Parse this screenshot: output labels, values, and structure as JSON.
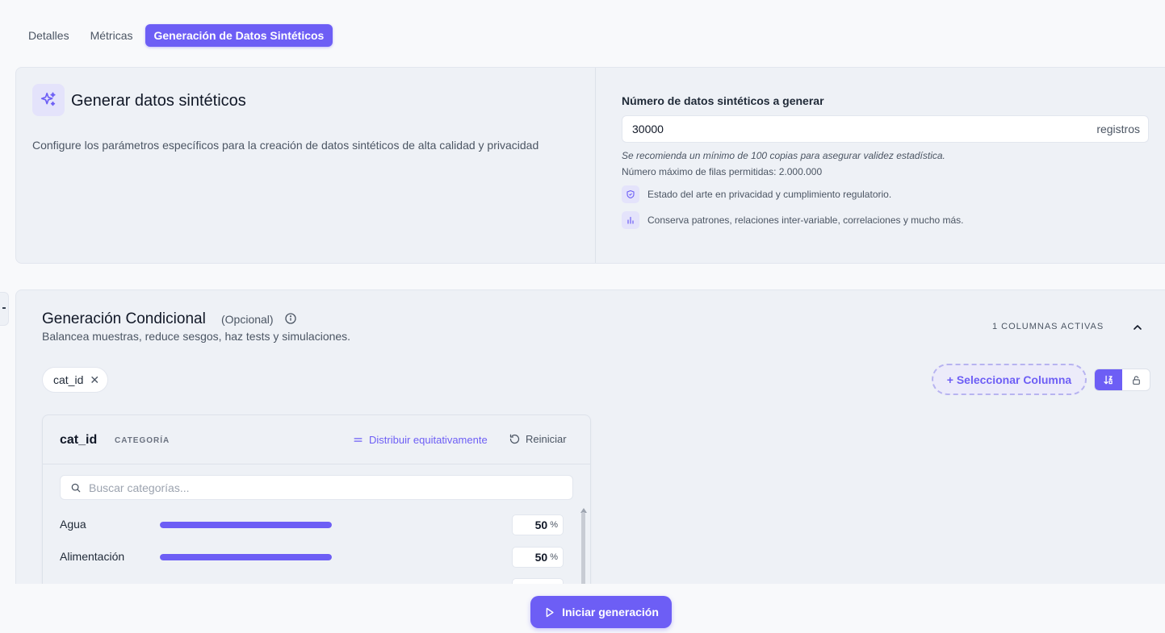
{
  "tabs": [
    {
      "label": "Detalles",
      "active": false
    },
    {
      "label": "Métricas",
      "active": false
    },
    {
      "label": "Generación de Datos Sintéticos",
      "active": true
    }
  ],
  "generate": {
    "title": "Generar datos sintéticos",
    "description": "Configure los parámetros específicos para la creación de datos sintéticos de alta calidad y privacidad",
    "field_label": "Número de datos sintéticos a generar",
    "count_value": "30000",
    "unit": "registros",
    "hint": "Se recomienda un mínimo de 100 copias para asegurar validez estadística.",
    "max_rows": "Número máximo de filas permitidas: 2.000.000",
    "features": [
      {
        "icon": "shield-icon",
        "text": "Estado del arte en privacidad y cumplimiento regulatorio."
      },
      {
        "icon": "bar-chart-icon",
        "text": "Conserva patrones, relaciones inter-variable, correlaciones y mucho más."
      }
    ]
  },
  "conditional": {
    "title": "Generación Condicional",
    "optional": "(Opcional)",
    "subtitle": "Balancea muestras, reduce sesgos, haz tests y simulaciones.",
    "active_columns": "1 COLUMNAS ACTIVAS",
    "chips": [
      {
        "label": "cat_id"
      }
    ],
    "select_column": "+ Seleccionar Columna",
    "column": {
      "name": "cat_id",
      "type": "CATEGORÍA",
      "distribute": "Distribuir equitativamente",
      "reset": "Reiniciar",
      "search_placeholder": "Buscar categorías...",
      "categories": [
        {
          "label": "Agua",
          "value": "50",
          "fraction": 1.0
        },
        {
          "label": "Alimentación",
          "value": "50",
          "fraction": 1.0
        }
      ],
      "percent_sign": "%"
    }
  },
  "footer": {
    "start_label": "Iniciar generación"
  },
  "colors": {
    "accent": "#6d5ef5",
    "card_bg": "#eef1f6",
    "page_bg": "#f8f9fb"
  }
}
